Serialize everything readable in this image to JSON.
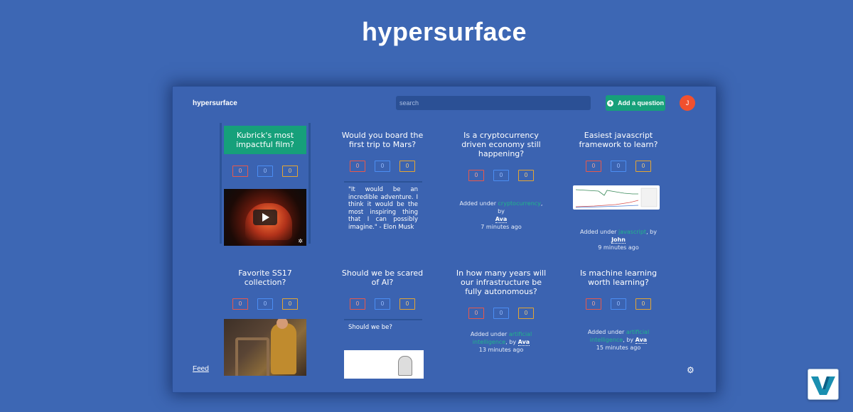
{
  "page_title": "hypersurface",
  "header": {
    "brand": "hypersurface",
    "search_placeholder": "search",
    "add_button_label": "Add a question",
    "avatar_initial": "J"
  },
  "cards": [
    {
      "title": "Kubrick's most impactful film?",
      "votes": [
        "0",
        "0",
        "0"
      ],
      "media": "video",
      "icon": "play-icon"
    },
    {
      "title": "Would you board the first trip to Mars?",
      "votes": [
        "0",
        "0",
        "0"
      ],
      "quote": "\"It would be an incredible adventure. I think it would be the most inspiring thing that I can possibly imagine.\" - Elon Musk"
    },
    {
      "title": "Is a cryptocurrency driven economy still happening?",
      "votes": [
        "0",
        "0",
        "0"
      ],
      "added_prefix": "Added under",
      "tag": "cryptocurrency",
      "by": ", by",
      "author": "Ava",
      "time": "7 minutes ago"
    },
    {
      "title": "Easiest javascript framework to learn?",
      "votes": [
        "0",
        "0",
        "0"
      ],
      "added_prefix": "Added under",
      "tag": "javascript",
      "by": ", by",
      "author": "John",
      "time": "9 minutes ago"
    },
    {
      "title": "Favorite SS17 collection?",
      "votes": [
        "0",
        "0",
        "0"
      ],
      "media": "photo"
    },
    {
      "title": "Should we be scared of AI?",
      "votes": [
        "0",
        "0",
        "0"
      ],
      "quote": "Should we be?"
    },
    {
      "title": "In how many years will our infrastructure be fully autonomous?",
      "votes": [
        "0",
        "0",
        "0"
      ],
      "added_prefix": "Added under",
      "tag": "artificial intelligence",
      "by": ", by",
      "author": "Ava",
      "time": "13 minutes ago"
    },
    {
      "title": "Is machine learning worth learning?",
      "votes": [
        "0",
        "0",
        "0"
      ],
      "added_prefix": "Added under",
      "tag": "artificial intelligence",
      "by": ", by",
      "author": "Ava",
      "time": "15 minutes ago"
    }
  ],
  "footer": {
    "feed_label": "Feed"
  },
  "colors": {
    "background": "#3d67b4",
    "accent_green": "#16a07a",
    "avatar": "#f1502e",
    "vote_red": "#e8594a",
    "vote_blue": "#4c8ef3",
    "vote_gold": "#e6a532"
  }
}
